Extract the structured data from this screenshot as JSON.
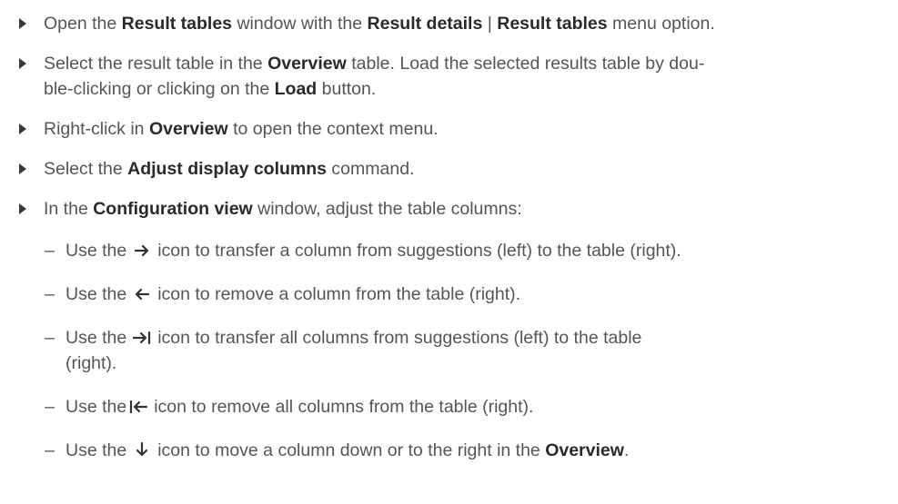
{
  "steps": [
    {
      "t1": "Open the ",
      "b1": "Result tables",
      "t2": " window with the ",
      "b2": "Result details",
      "t3": " | ",
      "b3": "Result tables",
      "t4": " menu option."
    },
    {
      "t1": "Select the result table in the ",
      "b1": "Overview",
      "t2": " table. Load the selected results table by dou-",
      "line2_t1": "ble-clicking or clicking on the ",
      "line2_b1": "Load",
      "line2_t2": " button."
    },
    {
      "t1": "Right-click in ",
      "b1": "Overview",
      "t2": " to open the context menu."
    },
    {
      "t1": "Select the ",
      "b1": "Adjust display columns",
      "t2": " command."
    },
    {
      "t1": "In the ",
      "b1": "Configuration view",
      "t2": " window, adjust the table columns:"
    }
  ],
  "substeps": [
    {
      "dash": "–",
      "pre": "Use the",
      "icon": "arrow-right-icon",
      "post": "icon to transfer a column from suggestions (left) to the table (right)."
    },
    {
      "dash": "–",
      "pre": "Use the",
      "icon": "arrow-left-icon",
      "post": "icon to remove a column from the table (right)."
    },
    {
      "dash": "–",
      "pre": "Use the",
      "icon": "arrow-right-to-bar-icon",
      "post": "icon to transfer all columns from suggestions (left) to the table",
      "line2": "(right)."
    },
    {
      "dash": "–",
      "pre": "Use the",
      "icon": "arrow-left-from-bar-icon",
      "post": "icon to remove all columns from the table (right)."
    },
    {
      "dash": "–",
      "pre": "Use the",
      "icon": "arrow-down-icon",
      "post": "icon to move a column down or to the right in the ",
      "bold": "Overview",
      "end": "."
    }
  ]
}
